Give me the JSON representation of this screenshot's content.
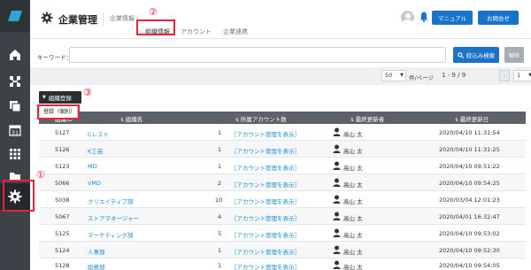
{
  "sidebar": {
    "items": [
      {
        "icon": "home-icon"
      },
      {
        "icon": "nodes-icon"
      },
      {
        "icon": "stack-icon"
      },
      {
        "icon": "calendar-icon",
        "label": "31"
      },
      {
        "icon": "grid-icon"
      },
      {
        "icon": "folder-icon"
      },
      {
        "icon": "gear-icon"
      }
    ]
  },
  "header": {
    "title": "企業管理",
    "tabs": [
      {
        "label": "企業情報",
        "active": false
      },
      {
        "label": "組織情報",
        "active": true
      },
      {
        "label": "アカウント",
        "active": false
      },
      {
        "label": "企業連携",
        "active": false
      }
    ],
    "manual_label": "マニュアル",
    "contact_label": "お問合せ"
  },
  "annotations": {
    "tab": "②",
    "dropdown": "③",
    "sidebar": "①"
  },
  "search": {
    "label": "キーワード：",
    "value": "",
    "placeholder": "",
    "search_button": "絞込み検索",
    "clear_button": "解除"
  },
  "pager": {
    "per_page": "50",
    "per_page_label": "件/ページ",
    "range": "1 - 9 / 9",
    "page": "1"
  },
  "actions": {
    "dropdown_label": "組織登録",
    "menu_item": "登録（個別）"
  },
  "table": {
    "headers": [
      "組織ID",
      "組織名",
      "所属アカウント数",
      "最終更新者",
      "最終更新日"
    ],
    "rows": [
      {
        "id": "5127",
        "name": "Cレスト",
        "count": "1",
        "link": "［アカウント管理を表示］",
        "updater": "高山 太",
        "date": "2020/04/10 11:31:54"
      },
      {
        "id": "5126",
        "name": "K工芸",
        "count": "1",
        "link": "［アカウント管理を表示］",
        "updater": "高山 太",
        "date": "2020/04/10 11:31:25"
      },
      {
        "id": "5123",
        "name": "MD",
        "count": "1",
        "link": "［アカウント管理を表示］",
        "updater": "高山 太",
        "date": "2020/04/10 09:51:22"
      },
      {
        "id": "5066",
        "name": "VMD",
        "count": "2",
        "link": "［アカウント管理を表示］",
        "updater": "高山 太",
        "date": "2020/04/10 09:54:25"
      },
      {
        "id": "5038",
        "name": "クリエイティブ部",
        "count": "10",
        "link": "［アカウント管理を表示］",
        "updater": "高山 太",
        "date": "2020/03/04 12:01:23"
      },
      {
        "id": "5067",
        "name": "ストアマネージャー",
        "count": "4",
        "link": "［アカウント管理を表示］",
        "updater": "高山 太",
        "date": "2020/04/01 16:32:47"
      },
      {
        "id": "5125",
        "name": "マーケティング部",
        "count": "5",
        "link": "［アカウント管理を表示］",
        "updater": "高山 太",
        "date": "2020/04/10 09:53:02"
      },
      {
        "id": "5124",
        "name": "人事部",
        "count": "1",
        "link": "［アカウント管理を表示］",
        "updater": "高山 太",
        "date": "2020/04/10 09:52:30"
      },
      {
        "id": "5128",
        "name": "総務部",
        "count": "1",
        "link": "［アカウント管理を表示］",
        "updater": "高山 太",
        "date": "2020/04/10 09:54:05"
      }
    ]
  },
  "colors": {
    "accent": "#1a73c8",
    "annotation": "#e8233a",
    "sidebar": "#3d4248",
    "link": "#1a8ed6"
  }
}
